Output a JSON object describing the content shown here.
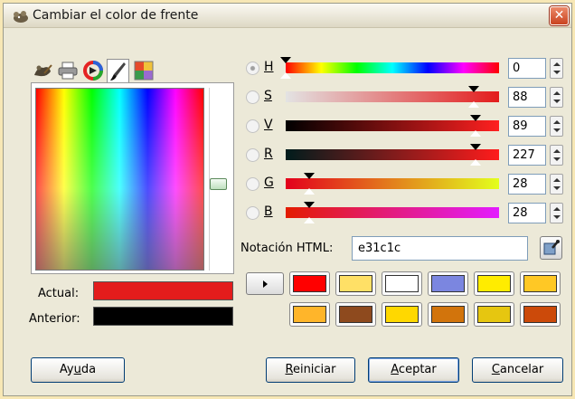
{
  "window": {
    "title": "Cambiar el color de frente",
    "close_symbol": "✕"
  },
  "tabs": [
    {
      "icon": "gimp-icon",
      "active": false
    },
    {
      "icon": "printer-icon",
      "active": false
    },
    {
      "icon": "color-wheel-icon",
      "active": false
    },
    {
      "icon": "brush-icon",
      "active": true
    },
    {
      "icon": "palette-icon",
      "active": false
    }
  ],
  "picker": {
    "actual_label": "Actual:",
    "anterior_label": "Anterior:",
    "actual_color": "#e31c1c",
    "anterior_color": "#000000",
    "value_fraction": 0.53
  },
  "channels": [
    {
      "id": "h",
      "key": "H",
      "value": "0",
      "fraction": 0.0,
      "selected": true,
      "gradient": "linear-gradient(to right,#ff0000,#ffff00,#00ff00,#00ffff,#0000ff,#ff00ff,#ff0000)"
    },
    {
      "id": "s",
      "key": "S",
      "value": "88",
      "fraction": 0.88,
      "selected": false,
      "gradient": "linear-gradient(to right,#e3e3e3,#e31c1c)"
    },
    {
      "id": "v",
      "key": "V",
      "value": "89",
      "fraction": 0.89,
      "selected": false,
      "gradient": "linear-gradient(to right,#000000,#ff2020)"
    },
    {
      "id": "r",
      "key": "R",
      "value": "227",
      "fraction": 0.89,
      "selected": false,
      "gradient": "linear-gradient(to right,#001c1c,#ff1c1c)"
    },
    {
      "id": "g",
      "key": "G",
      "value": "28",
      "fraction": 0.11,
      "selected": false,
      "gradient": "linear-gradient(to right,#e3001c,#e3ff1c)"
    },
    {
      "id": "b",
      "key": "B",
      "value": "28",
      "fraction": 0.11,
      "selected": false,
      "gradient": "linear-gradient(to right,#e31c00,#e31cff)"
    }
  ],
  "html_notation": {
    "label": "Notación HTML:",
    "value": "e31c1c"
  },
  "history": [
    [
      "#ff0000",
      "#ffe066",
      "#ffffff",
      "#7b86e0",
      "#ffec00",
      "#ffc825"
    ],
    [
      "#ffb52a",
      "#8e4a1e",
      "#ffd800",
      "#d2740c",
      "#e6c610",
      "#cc4a0a"
    ]
  ],
  "buttons": {
    "help": {
      "pre": "Ay",
      "ul": "u",
      "post": "da"
    },
    "reset": {
      "pre": "",
      "ul": "R",
      "post": "einiciar"
    },
    "accept": {
      "pre": "",
      "ul": "A",
      "post": "ceptar"
    },
    "cancel": {
      "pre": "",
      "ul": "C",
      "post": "ancelar"
    }
  }
}
